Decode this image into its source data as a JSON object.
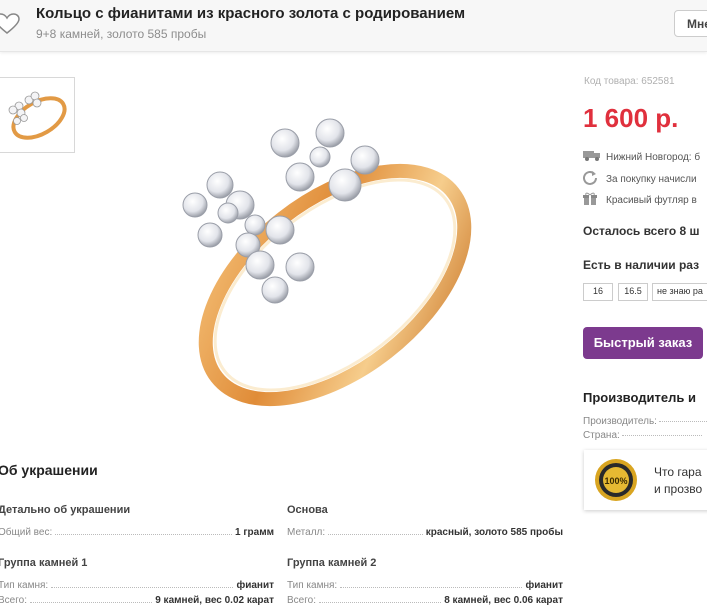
{
  "header": {
    "title": "Кольцо с фианитами из красного золота с родированием",
    "subtitle": "9+8 камней, золото 585 пробы",
    "button_label": "Мне"
  },
  "product": {
    "sku": "Код товара: 652581",
    "price": "1 600 р.",
    "features": [
      {
        "icon": "truck-icon",
        "text": "Нижний Новгород: б"
      },
      {
        "icon": "refresh-icon",
        "text": "За покупку начисли"
      },
      {
        "icon": "gift-icon",
        "text": "Красивый футляр в"
      }
    ],
    "left_count": "Осталось всего 8 ш",
    "availability": "Есть в наличии раз",
    "sizes": [
      "16",
      "16.5",
      "не знаю ра"
    ],
    "quick_order": "Быстрый заказ"
  },
  "maker": {
    "title": "Производитель и",
    "rows": [
      {
        "label": "Производитель:"
      },
      {
        "label": "Страна:"
      }
    ],
    "guarantee_line1": "Что гара",
    "guarantee_line2": "и прозво",
    "badge_text": "100%"
  },
  "specs": {
    "heading": "Об украшении",
    "sections": [
      {
        "title": "Детально об украшении",
        "rows": [
          {
            "label": "Общий вес:",
            "value": "1 грамм"
          }
        ]
      },
      {
        "title": "Основа",
        "rows": [
          {
            "label": "Металл:",
            "value": "красный, золото 585 пробы"
          }
        ]
      },
      {
        "title": "Группа камней 1",
        "rows": [
          {
            "label": "Тип камня:",
            "value": "фианит"
          },
          {
            "label": "Всего:",
            "value": "9 камней, вес 0.02 карат"
          }
        ]
      },
      {
        "title": "Группа камней 2",
        "rows": [
          {
            "label": "Тип камня:",
            "value": "фианит"
          },
          {
            "label": "Всего:",
            "value": "8 камней, вес 0.06 карат"
          }
        ]
      }
    ]
  },
  "colors": {
    "price": "#e0303d",
    "quick_order_bg": "#7c3a8e",
    "gold": "#e29a45"
  }
}
